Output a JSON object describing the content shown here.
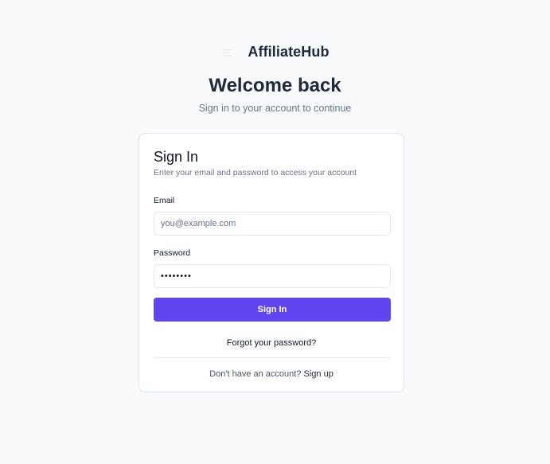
{
  "brand": {
    "name": "AffiliateHub",
    "icon": "menu-icon"
  },
  "header": {
    "title": "Welcome back",
    "subtitle": "Sign in to your account to continue"
  },
  "card": {
    "title": "Sign In",
    "description": "Enter your email and password to access your account",
    "email": {
      "label": "Email",
      "placeholder": "you@example.com",
      "value": ""
    },
    "password": {
      "label": "Password",
      "value": "••••••••"
    },
    "submit_label": "Sign In",
    "forgot_label": "Forgot your password?",
    "signup_prompt": "Don't have an account?",
    "signup_label": "Sign up"
  },
  "colors": {
    "accent": "#6145ef",
    "background": "#f8fafc",
    "heading": "#1e293b",
    "muted": "#64748b"
  }
}
